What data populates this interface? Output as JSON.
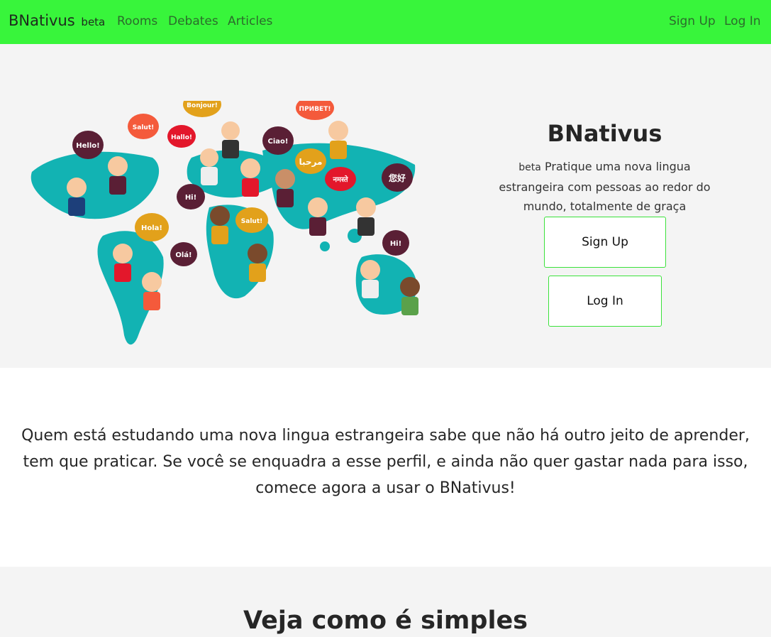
{
  "nav": {
    "brand": "BNativus",
    "brand_badge": "beta",
    "links": [
      "Rooms",
      "Debates",
      "Articles"
    ],
    "sign_up": "Sign Up",
    "log_in": "Log In"
  },
  "hero": {
    "illustration": {
      "bubbles": [
        "Hello!",
        "Salut!",
        "Bonjour!",
        "Hallo!",
        "Ciao!",
        "ПРИВЕТ!",
        "مرحبا",
        "नमस्ते",
        "您好",
        "Hi!",
        "Salut!",
        "Hola!",
        "Olá!",
        "Hi!"
      ]
    },
    "title": "BNativus",
    "badge": "beta",
    "description": "Pratique uma nova lingua estrangeira com pessoas ao redor do mundo, totalmente de graça",
    "sign_up": "Sign Up",
    "log_in": "Log In"
  },
  "intro": {
    "text": "Quem está estudando uma nova lingua estrangeira sabe que não há outro jeito de aprender, tem que praticar. Se você se enquadra a esse perfil, e ainda não quer gastar nada para isso, comece agora a usar o BNativus!"
  },
  "how": {
    "title": "Veja como é simples"
  },
  "colors": {
    "nav_bg": "#38f53b",
    "accent_border": "#3be23b",
    "map_teal": "#12b3b3",
    "hero_bg": "#f4f4f4"
  }
}
